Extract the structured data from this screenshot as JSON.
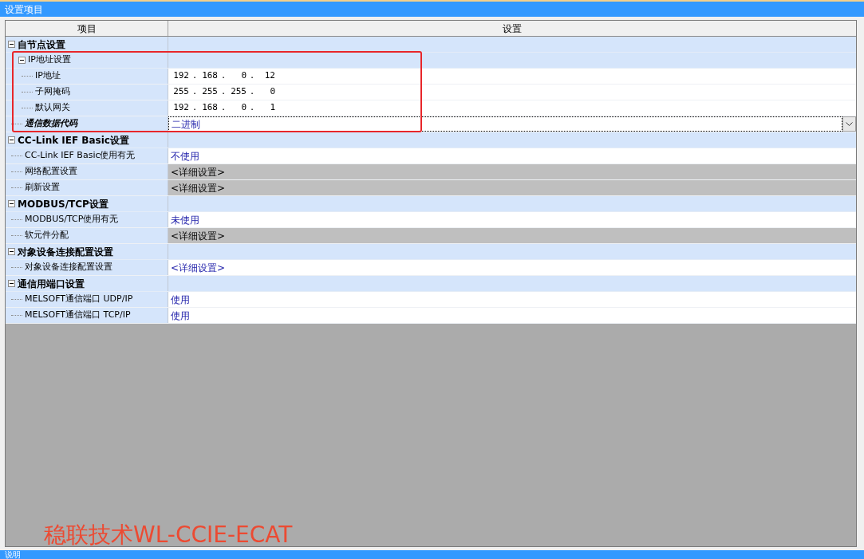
{
  "window": {
    "title": "设置项目"
  },
  "table": {
    "columns": [
      "项目",
      "设置"
    ],
    "rows": [
      {
        "kind": "group",
        "label": "自节点设置",
        "expanded": true,
        "children": [
          {
            "kind": "group",
            "label": "IP地址设置",
            "expanded": true,
            "children": [
              {
                "kind": "item",
                "label": "IP地址",
                "modified": false,
                "value": {
                  "kind": "ip",
                  "separator": ".",
                  "octets": [
                    "192",
                    "168",
                    "0",
                    "12"
                  ]
                }
              },
              {
                "kind": "item",
                "label": "子网掩码",
                "modified": false,
                "value": {
                  "kind": "ip",
                  "separator": ".",
                  "octets": [
                    "255",
                    "255",
                    "255",
                    "0"
                  ]
                }
              },
              {
                "kind": "item",
                "label": "默认网关",
                "modified": false,
                "value": {
                  "kind": "ip",
                  "separator": ".",
                  "octets": [
                    "192",
                    "168",
                    "0",
                    "1"
                  ]
                }
              }
            ]
          },
          {
            "kind": "item",
            "label": "通信数据代码",
            "modified": true,
            "value": {
              "kind": "dropdown",
              "text": "二进制"
            }
          }
        ]
      },
      {
        "kind": "group",
        "label": "CC-Link IEF Basic设置",
        "expanded": true,
        "children": [
          {
            "kind": "item",
            "label": "CC-Link IEF Basic使用有无",
            "modified": false,
            "value": {
              "kind": "text",
              "text": "不使用"
            }
          },
          {
            "kind": "item",
            "label": "网络配置设置",
            "modified": false,
            "value": {
              "kind": "detail",
              "text": "<详细设置>"
            }
          },
          {
            "kind": "item",
            "label": "刷新设置",
            "modified": false,
            "value": {
              "kind": "detail",
              "text": "<详细设置>"
            }
          }
        ]
      },
      {
        "kind": "group",
        "label": "MODBUS/TCP设置",
        "expanded": true,
        "children": [
          {
            "kind": "item",
            "label": "MODBUS/TCP使用有无",
            "modified": false,
            "value": {
              "kind": "text",
              "text": "未使用"
            }
          },
          {
            "kind": "item",
            "label": "软元件分配",
            "modified": false,
            "value": {
              "kind": "detail",
              "text": "<详细设置>"
            }
          }
        ]
      },
      {
        "kind": "group",
        "label": "对象设备连接配置设置",
        "expanded": true,
        "children": [
          {
            "kind": "item",
            "label": "对象设备连接配置设置",
            "modified": false,
            "value": {
              "kind": "text",
              "text": "<详细设置>"
            }
          }
        ]
      },
      {
        "kind": "group",
        "label": "通信用端口设置",
        "expanded": true,
        "children": [
          {
            "kind": "item",
            "label": "MELSOFT通信端口 UDP/IP",
            "modified": false,
            "value": {
              "kind": "text",
              "text": "使用"
            }
          },
          {
            "kind": "item",
            "label": "MELSOFT通信端口 TCP/IP",
            "modified": false,
            "value": {
              "kind": "text",
              "text": "使用"
            }
          }
        ]
      }
    ]
  },
  "annotation": {
    "caption": "稳联技术WL-CCIE-ECAT"
  },
  "bottom_panel": {
    "title": "说明"
  }
}
